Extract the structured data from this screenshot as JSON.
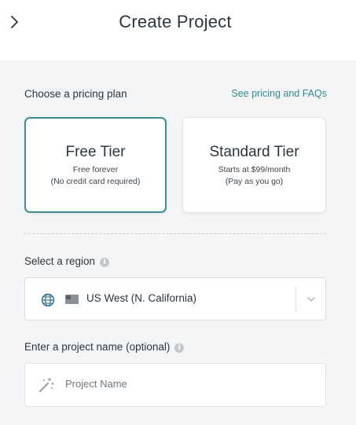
{
  "header": {
    "title": "Create Project",
    "back_icon": "chevron-right-icon"
  },
  "pricing": {
    "label": "Choose a pricing plan",
    "link": "See pricing and FAQs",
    "plans": [
      {
        "name": "Free Tier",
        "line1": "Free forever",
        "line2": "(No credit card required)",
        "selected": true
      },
      {
        "name": "Standard Tier",
        "line1": "Starts at $99/month",
        "line2": "(Pay as you go)",
        "selected": false
      }
    ]
  },
  "region": {
    "label": "Select a region",
    "info_icon": "i",
    "value": "US West (N. California)"
  },
  "project_name": {
    "label": "Enter a project name (optional)",
    "info_icon": "i",
    "placeholder": "Project Name"
  },
  "colors": {
    "accent": "#3d8d93",
    "link": "#2f8c8a",
    "background": "#f4f5f6"
  }
}
